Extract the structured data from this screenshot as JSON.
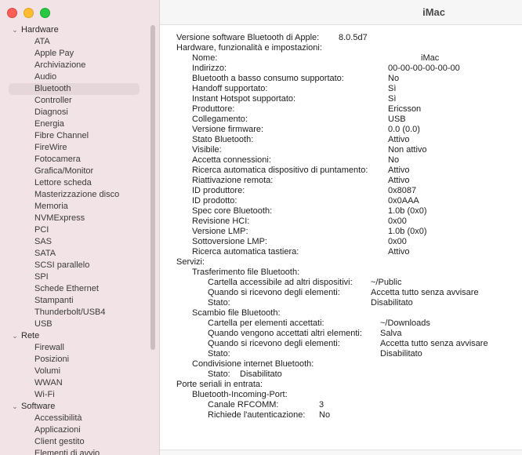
{
  "window": {
    "title": "iMac"
  },
  "sidebar": {
    "groups": [
      {
        "label": "Hardware",
        "items": [
          "ATA",
          "Apple Pay",
          "Archiviazione",
          "Audio",
          "Bluetooth",
          "Controller",
          "Diagnosi",
          "Energia",
          "Fibre Channel",
          "FireWire",
          "Fotocamera",
          "Grafica/Monitor",
          "Lettore scheda",
          "Masterizzazione disco",
          "Memoria",
          "NVMExpress",
          "PCI",
          "SAS",
          "SATA",
          "SCSI parallelo",
          "SPI",
          "Schede Ethernet",
          "Stampanti",
          "Thunderbolt/USB4",
          "USB"
        ]
      },
      {
        "label": "Rete",
        "items": [
          "Firewall",
          "Posizioni",
          "Volumi",
          "WWAN",
          "Wi-Fi"
        ]
      },
      {
        "label": "Software",
        "items": [
          "Accessibilità",
          "Applicazioni",
          "Client gestito",
          "Elementi di avvio"
        ]
      }
    ],
    "selected": "Bluetooth"
  },
  "detail": {
    "lines": [
      {
        "label": "Versione software Bluetooth di Apple:",
        "value": "8.0.5d7",
        "indent": 0
      },
      {
        "label": "Hardware, funzionalità e impostazioni:",
        "value": "",
        "indent": 0
      },
      {
        "label": "Nome:",
        "value": "iMac",
        "indent": 1
      },
      {
        "label": "Indirizzo:",
        "value": "00-00-00-00-00-00",
        "indent": 1
      },
      {
        "label": "Bluetooth a basso consumo supportato:",
        "value": "No",
        "indent": 1
      },
      {
        "label": "Handoff supportato:",
        "value": "Sì",
        "indent": 1
      },
      {
        "label": "Instant Hotspot supportato:",
        "value": "Sì",
        "indent": 1
      },
      {
        "label": "Produttore:",
        "value": "Ericsson",
        "indent": 1
      },
      {
        "label": "Collegamento:",
        "value": "USB",
        "indent": 1
      },
      {
        "label": "Versione firmware:",
        "value": "0.0 (0.0)",
        "indent": 1
      },
      {
        "label": "Stato Bluetooth:",
        "value": "Attivo",
        "indent": 1
      },
      {
        "label": "Visibile:",
        "value": "Non attivo",
        "indent": 1
      },
      {
        "label": "Accetta connessioni:",
        "value": "No",
        "indent": 1
      },
      {
        "label": "Ricerca automatica dispositivo di puntamento:",
        "value": "Attivo",
        "indent": 1
      },
      {
        "label": "Riattivazione remota:",
        "value": "Attivo",
        "indent": 1
      },
      {
        "label": "ID produttore:",
        "value": "0x8087",
        "indent": 1
      },
      {
        "label": "ID prodotto:",
        "value": "0x0AAA",
        "indent": 1
      },
      {
        "label": "Spec core Bluetooth:",
        "value": "1.0b (0x0)",
        "indent": 1
      },
      {
        "label": "Revisione HCI:",
        "value": "0x00",
        "indent": 1
      },
      {
        "label": "Versione LMP:",
        "value": "1.0b (0x0)",
        "indent": 1
      },
      {
        "label": "Sottoversione LMP:",
        "value": "0x00",
        "indent": 1
      },
      {
        "label": "Ricerca automatica tastiera:",
        "value": "Attivo",
        "indent": 1
      },
      {
        "label": "Servizi:",
        "value": "",
        "indent": 0
      },
      {
        "label": "Trasferimento file Bluetooth:",
        "value": "",
        "indent": 1
      },
      {
        "label": "Cartella accessibile ad altri dispositivi:",
        "value": "~/Public",
        "indent": 2
      },
      {
        "label": "Quando si ricevono degli elementi:",
        "value": "Accetta tutto senza avvisare",
        "indent": 2
      },
      {
        "label": "Stato:",
        "value": "Disabilitato",
        "indent": 2
      },
      {
        "label": "Scambio file Bluetooth:",
        "value": "",
        "indent": 1
      },
      {
        "label": "Cartella per elementi accettati:",
        "value": "~/Downloads",
        "indent": 2
      },
      {
        "label": "Quando vengono accettati altri elementi:",
        "value": "Salva",
        "indent": 2
      },
      {
        "label": "Quando si ricevono degli elementi:",
        "value": "Accetta tutto senza avvisare",
        "indent": 2
      },
      {
        "label": "Stato:",
        "value": "Disabilitato",
        "indent": 2
      },
      {
        "label": "Condivisione internet Bluetooth:",
        "value": "",
        "indent": 1
      },
      {
        "label": "Stato:",
        "value": "Disabilitato",
        "indent": 2
      },
      {
        "label": "Porte seriali in entrata:",
        "value": "",
        "indent": 0
      },
      {
        "label": "Bluetooth-Incoming-Port:",
        "value": "",
        "indent": 1
      },
      {
        "label": "Canale RFCOMM:",
        "value": "3",
        "indent": 2
      },
      {
        "label": "Richiede l'autenticazione:",
        "value": "No",
        "indent": 2
      }
    ]
  }
}
